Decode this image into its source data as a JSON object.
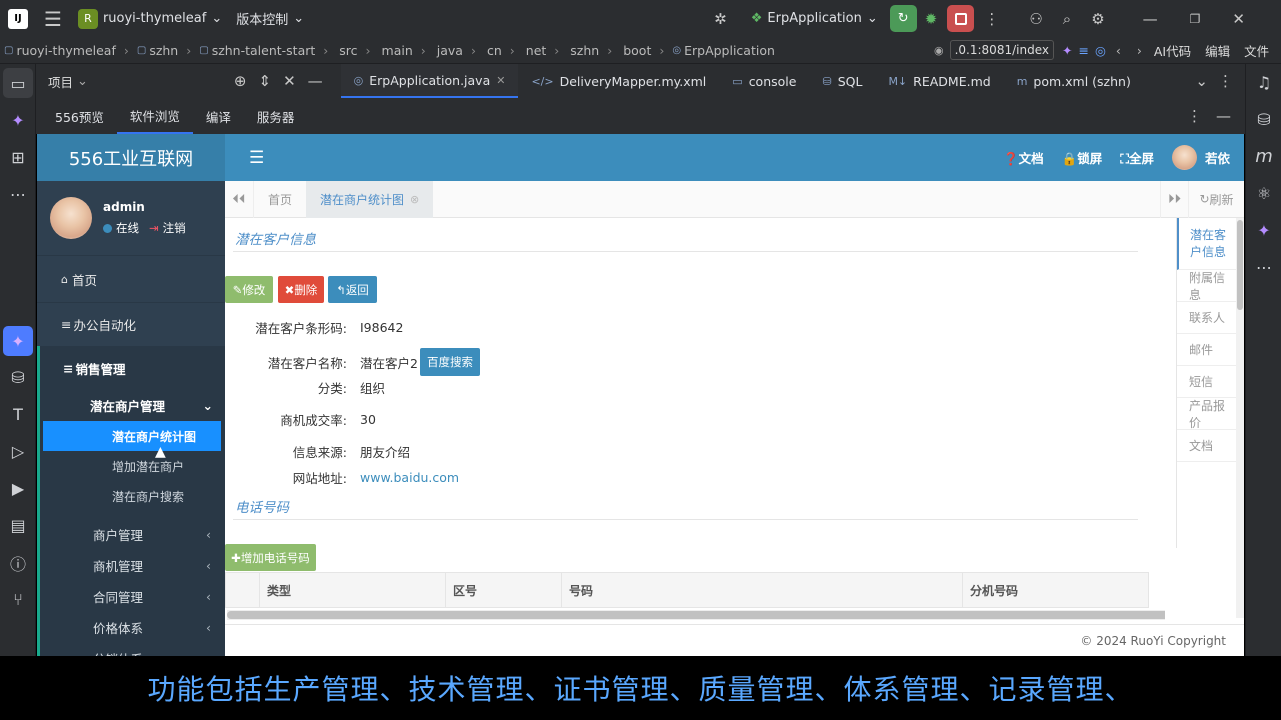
{
  "ide": {
    "project_name": "ruoyi-thymeleaf",
    "project_initial": "R",
    "vcs_label": "版本控制",
    "run_config": "ErpApplication",
    "breadcrumb": [
      "ruoyi-thymeleaf",
      "szhn",
      "szhn-talent-start",
      "src",
      "main",
      "java",
      "cn",
      "net",
      "szhn",
      "boot",
      "ErpApplication"
    ],
    "url": ".0.1:8081/index",
    "ai_label": "AI代码",
    "edit_label": "编辑",
    "file_label": "文件",
    "project_panel_label": "项目",
    "editor_tabs": [
      "ErpApplication.java",
      "DeliveryMapper.my.xml",
      "console",
      "SQL",
      "README.md",
      "pom.xml (szhn)"
    ],
    "sub_tabs": [
      "556预览",
      "软件浏览",
      "编译",
      "服务器"
    ]
  },
  "app": {
    "brand": "556工业互联网",
    "top_actions": [
      "文档",
      "锁屏",
      "全屏"
    ],
    "top_user": "若依",
    "user": {
      "name": "admin",
      "status": "在线",
      "logout": "注销"
    },
    "menu": {
      "home": "首页",
      "office": "办公自动化",
      "sales": "销售管理",
      "potential": "潜在商户管理",
      "sub_items": [
        "潜在商户统计图",
        "增加潜在商户",
        "潜在商户搜索"
      ],
      "groups": [
        "商户管理",
        "商机管理",
        "合同管理",
        "价格体系",
        "分销体系"
      ]
    },
    "tabs": {
      "home": "首页",
      "active": "潜在商户统计图",
      "refresh": "刷新"
    },
    "section_info": "潜在客户信息",
    "buttons": {
      "edit": "修改",
      "delete": "删除",
      "back": "返回",
      "baidu": "百度搜索",
      "add_phone": "增加电话号码"
    },
    "fields": [
      {
        "label": "潜在客户条形码:",
        "value": "I98642"
      },
      {
        "label": "潜在客户名称:",
        "value": "潜在客户2"
      },
      {
        "label": "分类:",
        "value": "组织"
      },
      {
        "label": "商机成交率:",
        "value": "30"
      },
      {
        "label": "信息来源:",
        "value": "朋友介绍"
      },
      {
        "label": "网站地址:",
        "value": "www.baidu.com"
      }
    ],
    "section_phone": "电话号码",
    "table_headers": [
      "类型",
      "区号",
      "号码",
      "分机号码"
    ],
    "right_tabs": [
      "潜在客户信息",
      "附属信息",
      "联系人",
      "邮件",
      "短信",
      "产品报价",
      "文档"
    ],
    "footer": "© 2024 RuoYi Copyright"
  },
  "subtitle": "功能包括生产管理、技术管理、证书管理、质量管理、体系管理、记录管理、",
  "colors": {
    "sidebar": "#2f4050",
    "topbar": "#3c8dbc",
    "active_menu": "#1890ff",
    "subtitle": "#5aa8ff"
  }
}
